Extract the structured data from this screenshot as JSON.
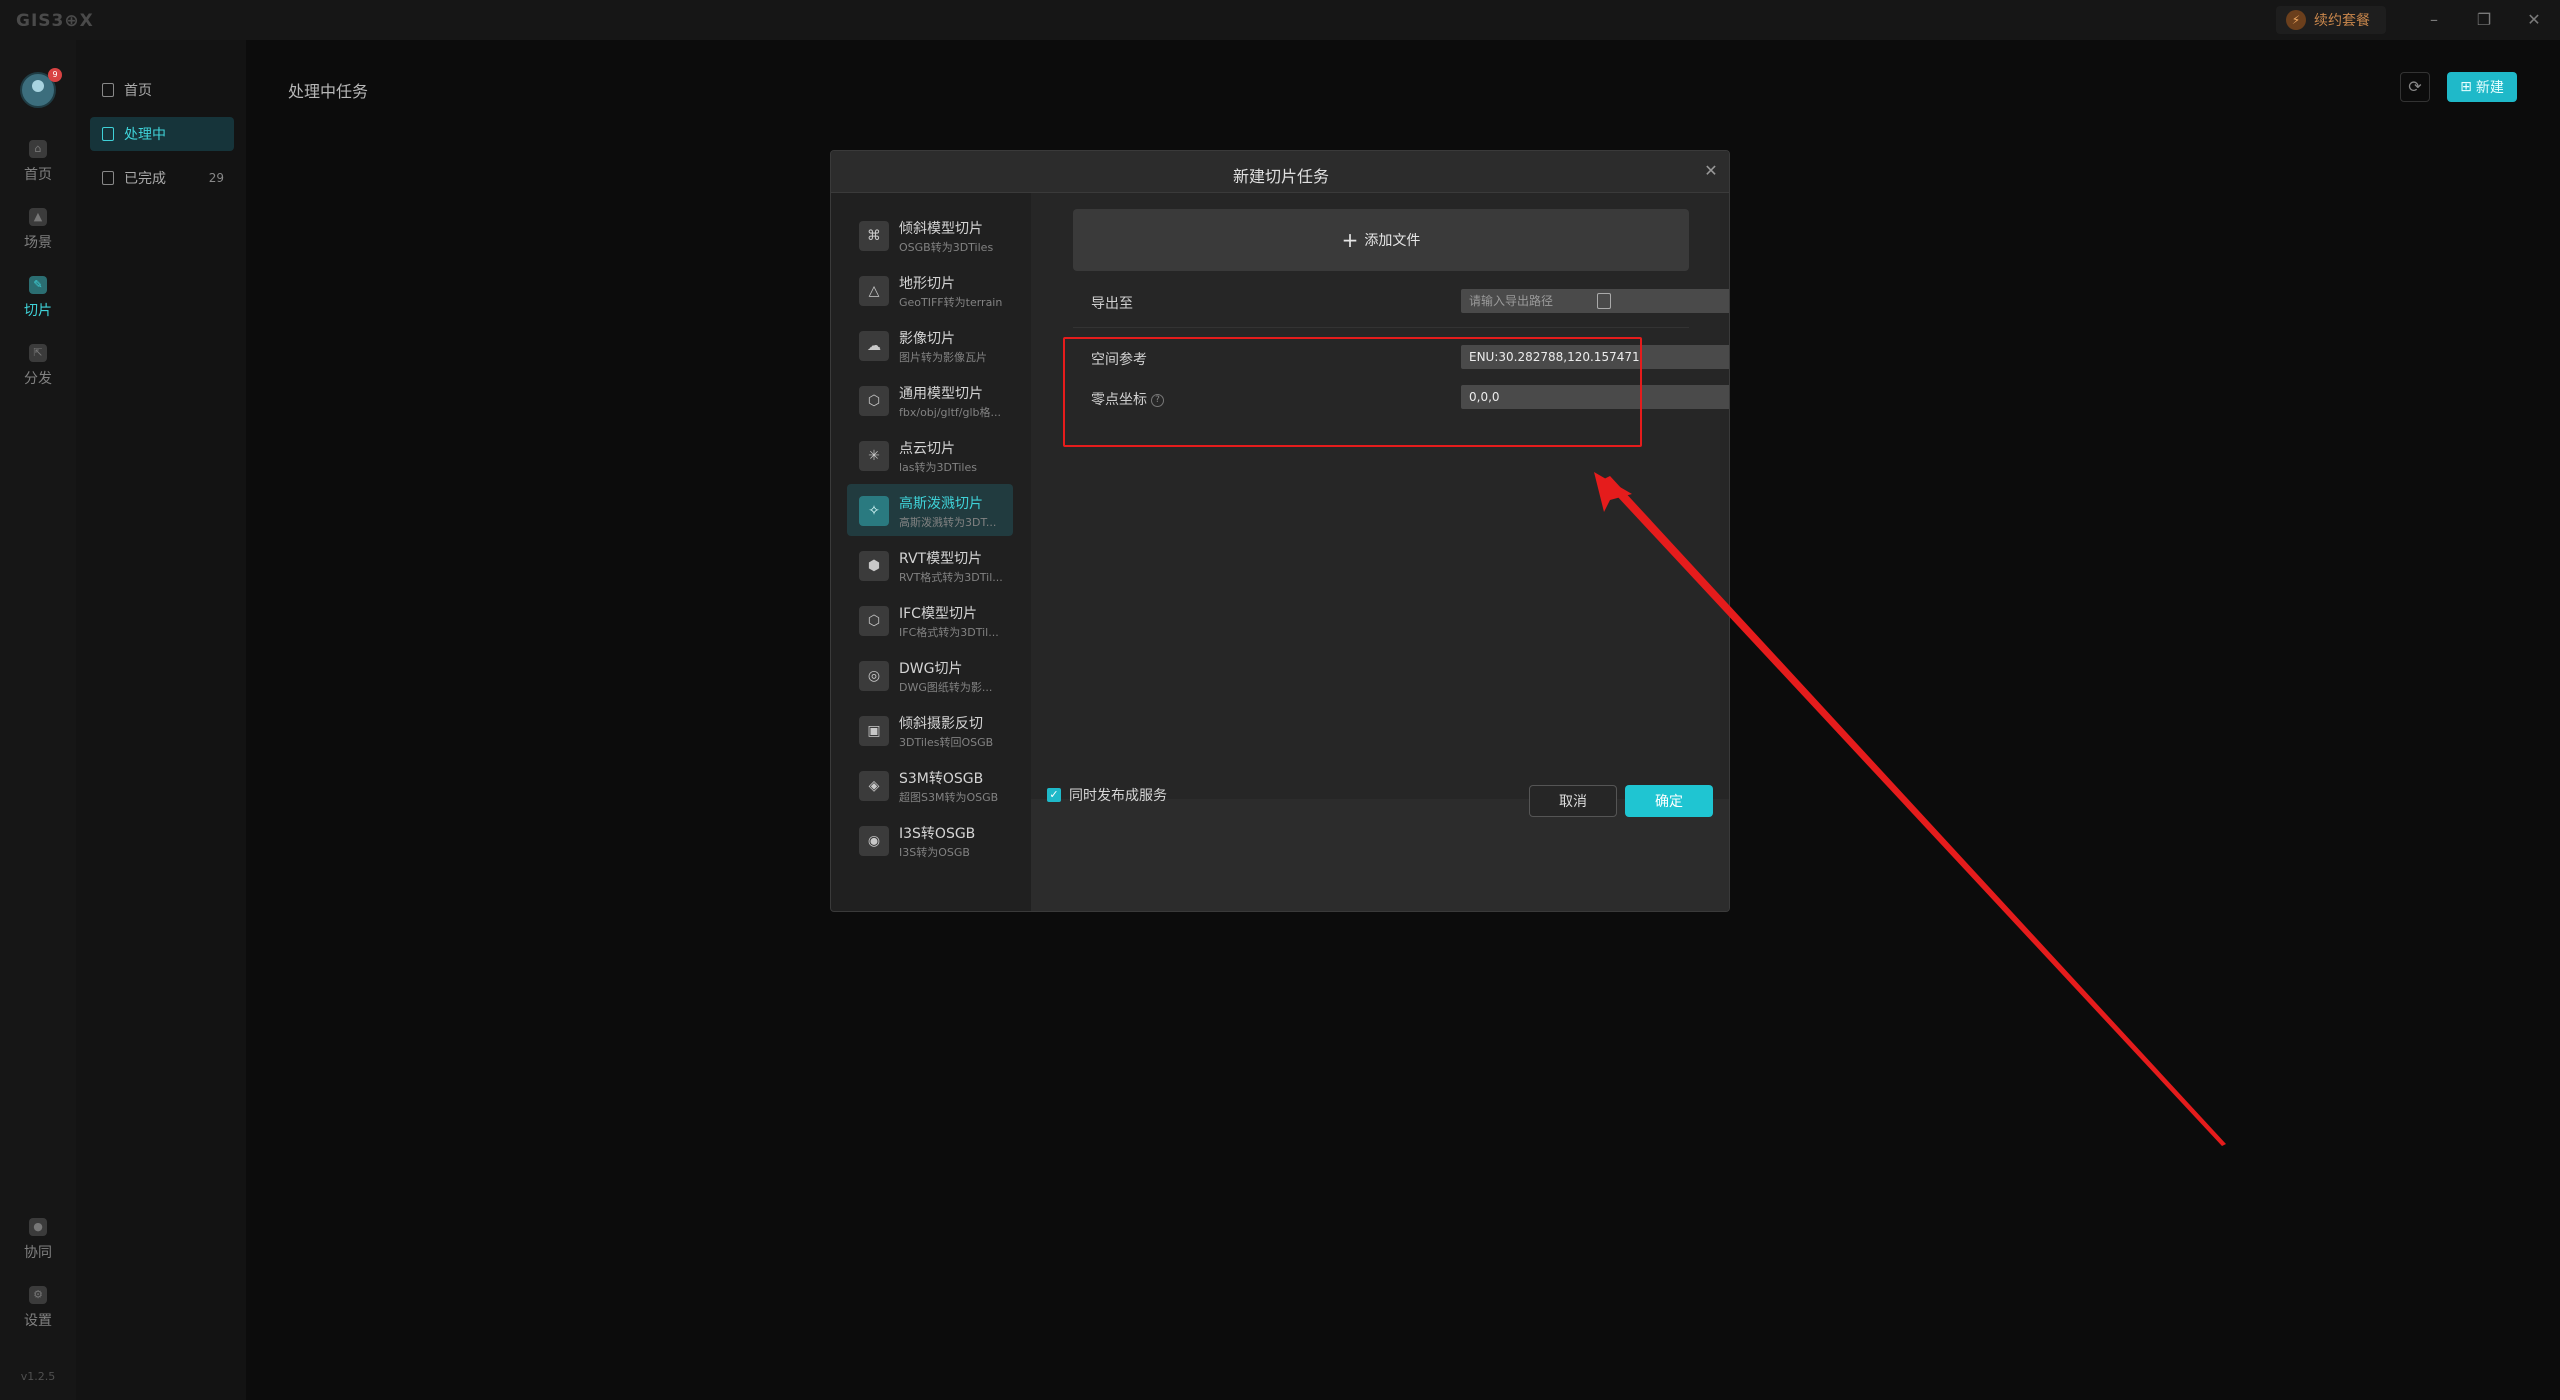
{
  "app": {
    "logo": "GIS3⊕X",
    "renew_label": "续约套餐",
    "version": "v1.2.5"
  },
  "window_controls": {
    "minimize": "–",
    "restore": "❐",
    "close": "✕"
  },
  "iconbar": {
    "items": [
      {
        "label": "首页",
        "icon": "home-icon"
      },
      {
        "label": "场景",
        "icon": "scene-icon"
      },
      {
        "label": "切片",
        "icon": "tile-icon",
        "active": true
      },
      {
        "label": "分发",
        "icon": "distribute-icon"
      }
    ],
    "bottom": [
      {
        "label": "协同",
        "icon": "lock-icon"
      },
      {
        "label": "设置",
        "icon": "gear-icon"
      }
    ],
    "badge": "9"
  },
  "sidebar": {
    "items": [
      {
        "label": "首页"
      },
      {
        "label": "处理中",
        "active": true
      },
      {
        "label": "已完成",
        "count": "29"
      }
    ]
  },
  "main": {
    "title": "处理中任务",
    "new_button": "新建",
    "refresh_icon": "refresh-icon"
  },
  "modal": {
    "title": "新建切片任务",
    "types": [
      {
        "name": "倾斜模型切片",
        "sub": "OSGB转为3DTiles"
      },
      {
        "name": "地形切片",
        "sub": "GeoTIFF转为terrain"
      },
      {
        "name": "影像切片",
        "sub": "图片转为影像瓦片"
      },
      {
        "name": "通用模型切片",
        "sub": "fbx/obj/gltf/glb格..."
      },
      {
        "name": "点云切片",
        "sub": "las转为3DTiles"
      },
      {
        "name": "高斯泼溅切片",
        "sub": "高斯泼溅转为3DT...",
        "active": true
      },
      {
        "name": "RVT模型切片",
        "sub": "RVT格式转为3DTil..."
      },
      {
        "name": "IFC模型切片",
        "sub": "IFC格式转为3DTil..."
      },
      {
        "name": "DWG切片",
        "sub": "DWG图纸转为影..."
      },
      {
        "name": "倾斜摄影反切",
        "sub": "3DTiles转回OSGB"
      },
      {
        "name": "S3M转OSGB",
        "sub": "超图S3M转为OSGB"
      },
      {
        "name": "I3S转OSGB",
        "sub": "I3S转为OSGB"
      }
    ],
    "type_glyphs": [
      "⌘",
      "△",
      "☁",
      "⬡",
      "✳",
      "✧",
      "⬢",
      "⬡",
      "◎",
      "▣",
      "◈",
      "◉"
    ],
    "add_file": "添加文件",
    "export_label": "导出至",
    "export_placeholder": "请输入导出路径",
    "spatial_label": "空间参考",
    "spatial_value": "ENU:30.282788,120.157471",
    "origin_label": "零点坐标",
    "origin_value": "0,0,0",
    "publish_label": "同时发布成服务",
    "publish_checked": true,
    "cancel": "取消",
    "ok": "确定"
  },
  "colors": {
    "accent": "#1fc5d2",
    "annotation_red": "#e51c1c"
  }
}
